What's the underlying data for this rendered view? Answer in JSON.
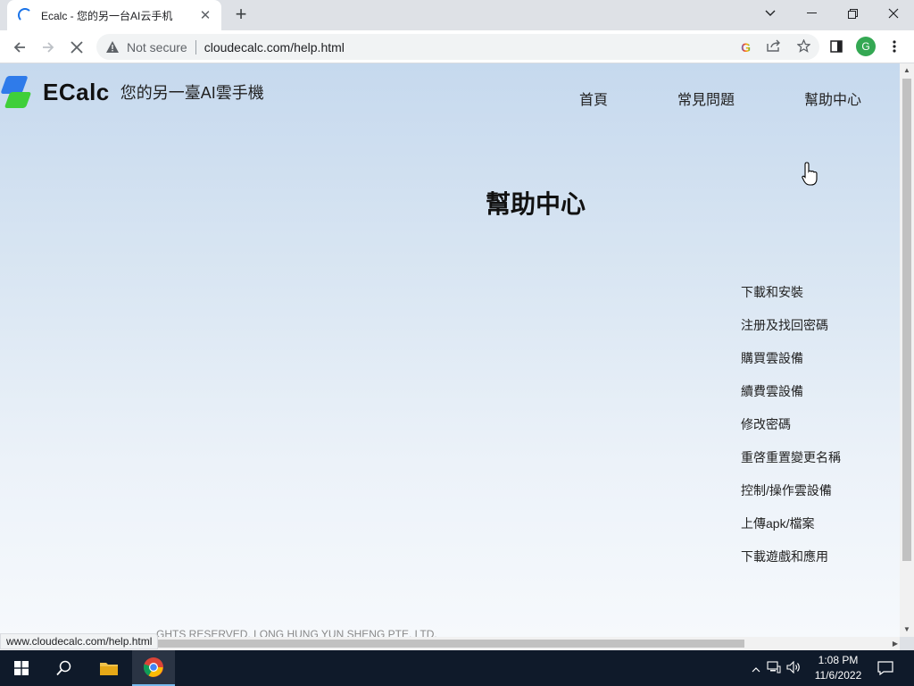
{
  "browser": {
    "tab_title": "Ecalc - 您的另一台AI云手机",
    "url": "cloudecalc.com/help.html",
    "security_label": "Not secure",
    "profile_initial": "G",
    "status_url": "www.cloudecalc.com/help.html"
  },
  "site": {
    "brand_name": "ECalc",
    "slogan": "您的另一臺AI雲手機",
    "nav": [
      "首頁",
      "常見問題",
      "幫助中心"
    ]
  },
  "page": {
    "title": "幫助中心",
    "help_links": [
      "下載和安裝",
      "注册及找回密碼",
      "購買雲設備",
      "續費雲設備",
      "修改密碼",
      "重啓重置變更名稱",
      "控制/操作雲設備",
      "上傳apk/檔案",
      "下載遊戲和應用"
    ],
    "footer": "GHTS RESERVED. LONG HUNG YUN SHENG PTE. LTD."
  },
  "taskbar": {
    "time": "1:08 PM",
    "date": "11/6/2022"
  },
  "colors": {
    "brand_blue": "#2f7bea",
    "brand_green": "#3fcf3a",
    "page_gradient_top": "#c6d9ee",
    "page_gradient_bottom": "#f6f9fc"
  }
}
